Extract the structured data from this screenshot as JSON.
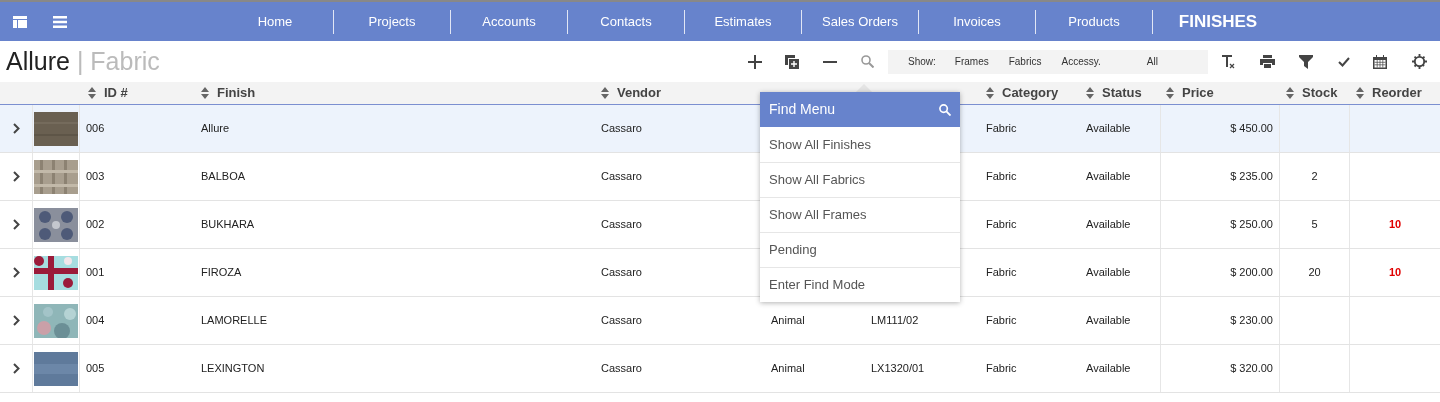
{
  "nav": {
    "items": [
      {
        "label": "Home",
        "selected": false
      },
      {
        "label": "Projects",
        "selected": false
      },
      {
        "label": "Accounts",
        "selected": false
      },
      {
        "label": "Contacts",
        "selected": false
      },
      {
        "label": "Estimates",
        "selected": false
      },
      {
        "label": "Sales Orders",
        "selected": false
      },
      {
        "label": "Invoices",
        "selected": false
      },
      {
        "label": "Products",
        "selected": false
      },
      {
        "label": "FINISHES",
        "selected": true
      }
    ]
  },
  "title": {
    "name": "Allure",
    "separator": "|",
    "type": "Fabric"
  },
  "show_filter": {
    "label": "Show:",
    "options": [
      "Frames",
      "Fabrics",
      "Accessy.",
      "All"
    ]
  },
  "table": {
    "columns": [
      "ID #",
      "Finish",
      "Vendor",
      "Category",
      "Status",
      "Price",
      "Stock",
      "Reorder"
    ],
    "rows": [
      {
        "id": "006",
        "finish": "Allure",
        "vendor": "Cassaro",
        "category": "Fabric",
        "status": "Available",
        "price": "$ 450.00",
        "selected": true
      },
      {
        "id": "003",
        "finish": "BALBOA",
        "vendor": "Cassaro",
        "category": "Fabric",
        "status": "Available",
        "price": "$ 235.00",
        "stock": "2",
        "selected": false
      },
      {
        "id": "002",
        "finish": "BUKHARA",
        "vendor": "Cassaro",
        "category": "Fabric",
        "status": "Available",
        "price": "$ 250.00",
        "stock": "5",
        "reorder": "10",
        "reorder_alert": true,
        "selected": false
      },
      {
        "id": "001",
        "finish": "FIROZA",
        "vendor": "Cassaro",
        "category": "Fabric",
        "status": "Available",
        "price": "$ 200.00",
        "stock": "20",
        "reorder": "10",
        "reorder_alert": true,
        "selected": false
      },
      {
        "id": "004",
        "finish": "LAMORELLE",
        "vendor": "Cassaro",
        "collection": "Animal",
        "sku": "LM111/02",
        "category": "Fabric",
        "status": "Available",
        "price": "$ 230.00",
        "selected": false
      },
      {
        "id": "005",
        "finish": "LEXINGTON",
        "vendor": "Cassaro",
        "collection": "Animal",
        "sku": "LX1320/01",
        "category": "Fabric",
        "status": "Available",
        "price": "$ 320.00",
        "selected": false
      }
    ]
  },
  "find_menu": {
    "title": "Find Menu",
    "items": [
      "Show All Finishes",
      "Show All Fabrics",
      "Show All Frames",
      "Pending",
      "Enter Find Mode"
    ]
  }
}
